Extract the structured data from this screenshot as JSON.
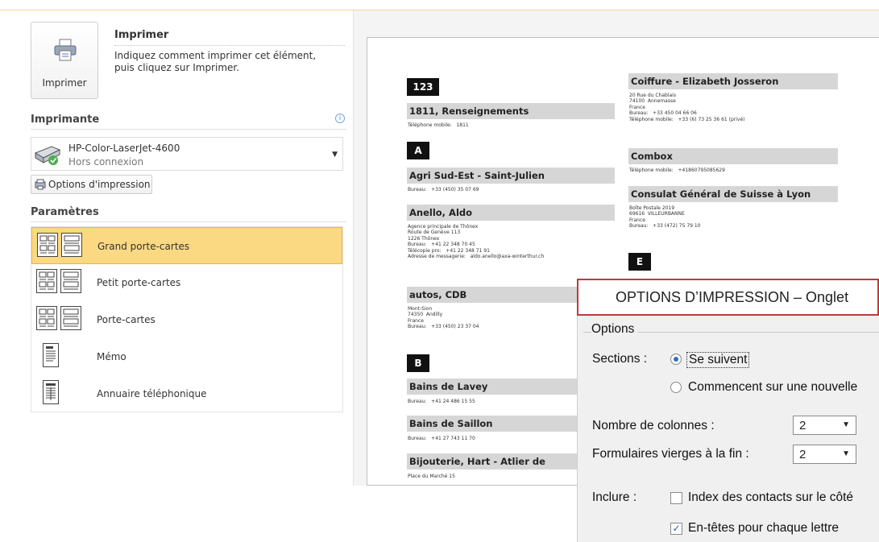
{
  "backstage": {
    "print_button_label": "Imprimer",
    "print_title": "Imprimer",
    "print_description": "Indiquez comment imprimer cet élément, puis cliquez sur Imprimer.",
    "printer_section_title": "Imprimante",
    "info_icon": "i",
    "printer_name": "HP-Color-LaserJet-4600",
    "printer_status": "Hors connexion",
    "print_options_button": "Options d'impression",
    "settings_title": "Paramètres",
    "styles": [
      {
        "label": "Grand porte-cartes",
        "icon": "card-style-icon",
        "selected": true
      },
      {
        "label": "Petit porte-cartes",
        "icon": "card-style-icon",
        "selected": false
      },
      {
        "label": "Porte-cartes",
        "icon": "card-style-icon",
        "selected": false
      },
      {
        "label": "Mémo",
        "icon": "memo-style-icon",
        "selected": false
      },
      {
        "label": "Annuaire téléphonique",
        "icon": "phone-directory-icon",
        "selected": false
      }
    ]
  },
  "preview": {
    "letters": [
      "123",
      "A",
      "B",
      "E"
    ],
    "contacts": [
      {
        "name": "1811, Renseignements",
        "details": "Téléphone mobile:   1811"
      },
      {
        "name": "Agri Sud-Est - Saint-Julien",
        "details": "Bureau:   +33 (450) 35 07 69"
      },
      {
        "name": "Anello, Aldo",
        "details": "Agence principale de Thônex\nRoute de Genève 113\n1226 Thônex\nBureau:   +41 22 348 70 45\nTélécopie pro:   +41 22 348 71 91\nAdresse de messagerie:   aldo.anello@axa-winterthur.ch"
      },
      {
        "name": "autos, CDB",
        "details": "Mont-Sion\n74350  Andilly\nFrance\nBureau:   +33 (450) 23 37 04"
      },
      {
        "name": "Bains de Lavey",
        "details": "Bureau:   +41 24 486 15 55"
      },
      {
        "name": "Bains de Saillon",
        "details": "Bureau:   +41 27 743 11 70"
      },
      {
        "name": "Bijouterie, Hart - Atlier de",
        "details": "Place du Marché 15"
      },
      {
        "name": "Coiffure - Elizabeth Josseron",
        "details": "20 Rue du Chablais\n74100  Annemasse\nFrance\nBureau:   +33 450 04 66 06\nTéléphone mobile:   +33 (6) 73 25 36 61 (privé)"
      },
      {
        "name": "Combox",
        "details": "Téléphone mobile:   +41860795085629"
      },
      {
        "name": "Consulat Général de Suisse à Lyon",
        "details": "Boîte Postale 2019\n69616  VILLEURBANNE\nFrance\nBureau:   +33 (472) 75 79 10"
      }
    ]
  },
  "dialog": {
    "banner": "OPTIONS D’IMPRESSION – Onglet",
    "group_label": "Options",
    "sections_label": "Sections :",
    "sections_option1": "Se suivent",
    "sections_option2": "Commencent sur une nouvelle",
    "columns_label": "Nombre de colonnes :",
    "columns_value": "2",
    "blank_forms_label": "Formulaires vierges à la fin :",
    "blank_forms_value": "2",
    "include_label": "Inclure :",
    "include_option1": "Index des contacts sur le côté",
    "include_option1_checked": false,
    "include_option2": "En-têtes pour chaque lettre",
    "include_option2_checked": true
  }
}
